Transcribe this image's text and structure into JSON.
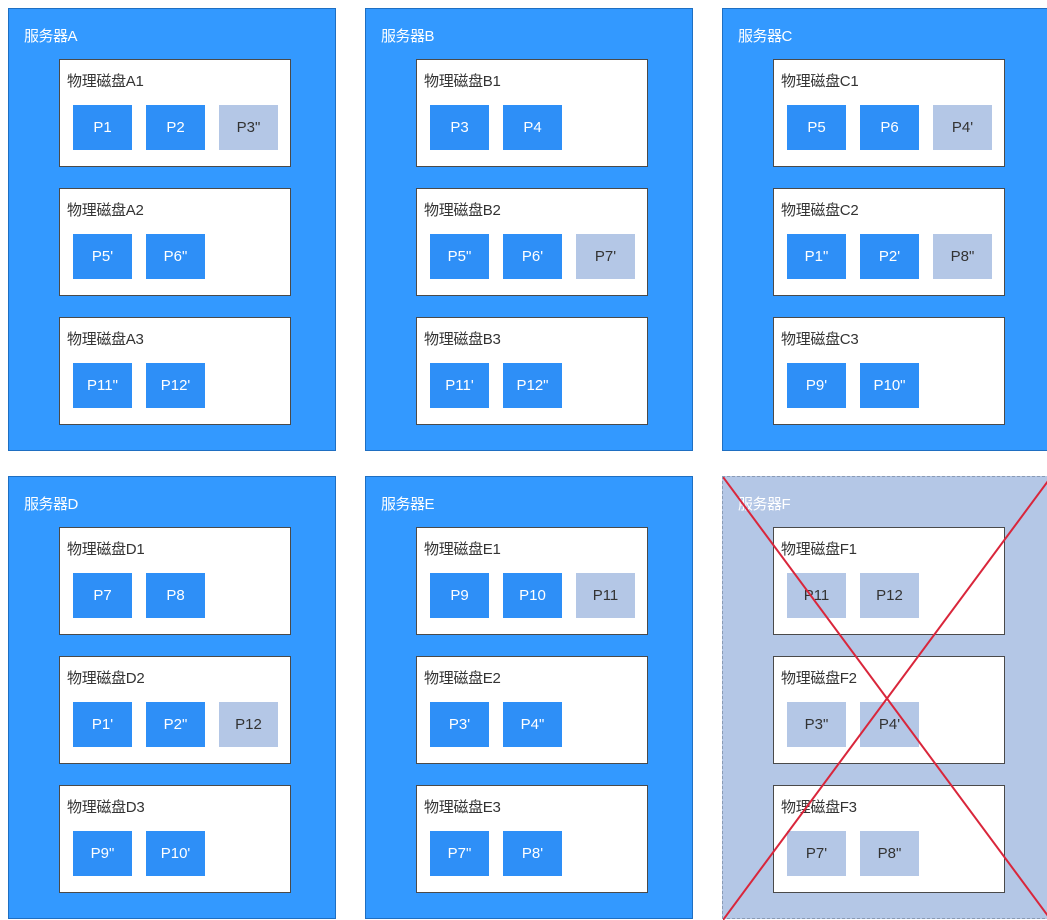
{
  "colors": {
    "server_active": "#3399ff",
    "server_failed": "#b4c7e6",
    "partition_primary": "#2e8ff7",
    "partition_replica": "#b4c7e6",
    "fail_mark": "#d9263b"
  },
  "servers": [
    {
      "name": "服务器A",
      "failed": false,
      "disks": [
        {
          "label": "物理磁盘A1",
          "partitions": [
            {
              "label": "P1",
              "style": "blue"
            },
            {
              "label": "P2",
              "style": "blue"
            },
            {
              "label": "P3\"",
              "style": "grey"
            }
          ]
        },
        {
          "label": "物理磁盘A2",
          "partitions": [
            {
              "label": "P5'",
              "style": "blue"
            },
            {
              "label": "P6\"",
              "style": "blue"
            }
          ]
        },
        {
          "label": "物理磁盘A3",
          "partitions": [
            {
              "label": "P11\"",
              "style": "blue"
            },
            {
              "label": "P12'",
              "style": "blue"
            }
          ]
        }
      ]
    },
    {
      "name": "服务器B",
      "failed": false,
      "disks": [
        {
          "label": "物理磁盘B1",
          "partitions": [
            {
              "label": "P3",
              "style": "blue"
            },
            {
              "label": "P4",
              "style": "blue"
            }
          ]
        },
        {
          "label": "物理磁盘B2",
          "partitions": [
            {
              "label": "P5\"",
              "style": "blue"
            },
            {
              "label": "P6'",
              "style": "blue"
            },
            {
              "label": "P7'",
              "style": "grey"
            }
          ]
        },
        {
          "label": "物理磁盘B3",
          "partitions": [
            {
              "label": "P11'",
              "style": "blue"
            },
            {
              "label": "P12\"",
              "style": "blue"
            }
          ]
        }
      ]
    },
    {
      "name": "服务器C",
      "failed": false,
      "disks": [
        {
          "label": "物理磁盘C1",
          "partitions": [
            {
              "label": "P5",
              "style": "blue"
            },
            {
              "label": "P6",
              "style": "blue"
            },
            {
              "label": "P4'",
              "style": "grey"
            }
          ]
        },
        {
          "label": "物理磁盘C2",
          "partitions": [
            {
              "label": "P1\"",
              "style": "blue"
            },
            {
              "label": "P2'",
              "style": "blue"
            },
            {
              "label": "P8\"",
              "style": "grey"
            }
          ]
        },
        {
          "label": "物理磁盘C3",
          "partitions": [
            {
              "label": "P9'",
              "style": "blue"
            },
            {
              "label": "P10\"",
              "style": "blue"
            }
          ]
        }
      ]
    },
    {
      "name": "服务器D",
      "failed": false,
      "disks": [
        {
          "label": "物理磁盘D1",
          "partitions": [
            {
              "label": "P7",
              "style": "blue"
            },
            {
              "label": "P8",
              "style": "blue"
            }
          ]
        },
        {
          "label": "物理磁盘D2",
          "partitions": [
            {
              "label": "P1'",
              "style": "blue"
            },
            {
              "label": "P2\"",
              "style": "blue"
            },
            {
              "label": "P12",
              "style": "grey"
            }
          ]
        },
        {
          "label": "物理磁盘D3",
          "partitions": [
            {
              "label": "P9\"",
              "style": "blue"
            },
            {
              "label": "P10'",
              "style": "blue"
            }
          ]
        }
      ]
    },
    {
      "name": "服务器E",
      "failed": false,
      "disks": [
        {
          "label": "物理磁盘E1",
          "partitions": [
            {
              "label": "P9",
              "style": "blue"
            },
            {
              "label": "P10",
              "style": "blue"
            },
            {
              "label": "P11",
              "style": "grey"
            }
          ]
        },
        {
          "label": "物理磁盘E2",
          "partitions": [
            {
              "label": "P3'",
              "style": "blue"
            },
            {
              "label": "P4\"",
              "style": "blue"
            }
          ]
        },
        {
          "label": "物理磁盘E3",
          "partitions": [
            {
              "label": "P7\"",
              "style": "blue"
            },
            {
              "label": "P8'",
              "style": "blue"
            }
          ]
        }
      ]
    },
    {
      "name": "服务器F",
      "failed": true,
      "disks": [
        {
          "label": "物理磁盘F1",
          "partitions": [
            {
              "label": "P11",
              "style": "grey"
            },
            {
              "label": "P12",
              "style": "grey"
            }
          ]
        },
        {
          "label": "物理磁盘F2",
          "partitions": [
            {
              "label": "P3\"",
              "style": "grey"
            },
            {
              "label": "P4'",
              "style": "grey"
            }
          ]
        },
        {
          "label": "物理磁盘F3",
          "partitions": [
            {
              "label": "P7'",
              "style": "grey"
            },
            {
              "label": "P8\"",
              "style": "grey"
            }
          ]
        }
      ]
    }
  ]
}
